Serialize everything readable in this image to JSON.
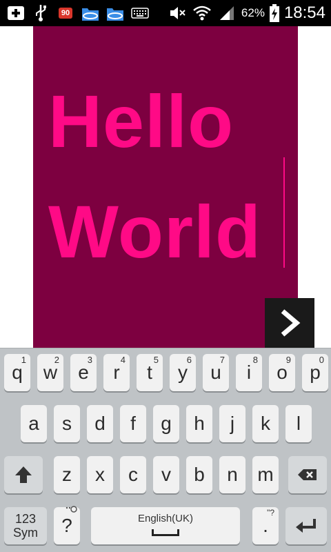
{
  "status_bar": {
    "notification_count": "90",
    "battery_percent": "62%",
    "time": "18:54",
    "icons": [
      "add-box-icon",
      "usb-icon",
      "notification-badge-icon",
      "es-file-explorer-icon",
      "es-file-explorer-icon",
      "keyboard-icon",
      "mute-icon",
      "wifi-icon",
      "signal-icon",
      "battery-charging-icon"
    ]
  },
  "editor": {
    "text_line1": "Hello",
    "text_line2": "World",
    "background_color": "#7d0040",
    "text_color": "#ff0a86"
  },
  "next_button": {
    "icon": "chevron-right-icon"
  },
  "keyboard": {
    "row1": [
      {
        "label": "q",
        "hint": "1"
      },
      {
        "label": "w",
        "hint": "2"
      },
      {
        "label": "e",
        "hint": "3"
      },
      {
        "label": "r",
        "hint": "4"
      },
      {
        "label": "t",
        "hint": "5"
      },
      {
        "label": "y",
        "hint": "6"
      },
      {
        "label": "u",
        "hint": "7"
      },
      {
        "label": "i",
        "hint": "8"
      },
      {
        "label": "o",
        "hint": "9"
      },
      {
        "label": "p",
        "hint": "0"
      }
    ],
    "row2": [
      "a",
      "s",
      "d",
      "f",
      "g",
      "h",
      "j",
      "k",
      "l"
    ],
    "row3": [
      "z",
      "x",
      "c",
      "v",
      "b",
      "n",
      "m"
    ],
    "sym_line1": "123",
    "sym_line2": "Sym",
    "question_key": "?",
    "space_label": "English(UK)",
    "period_key": ".",
    "period_hint": "\"?"
  }
}
